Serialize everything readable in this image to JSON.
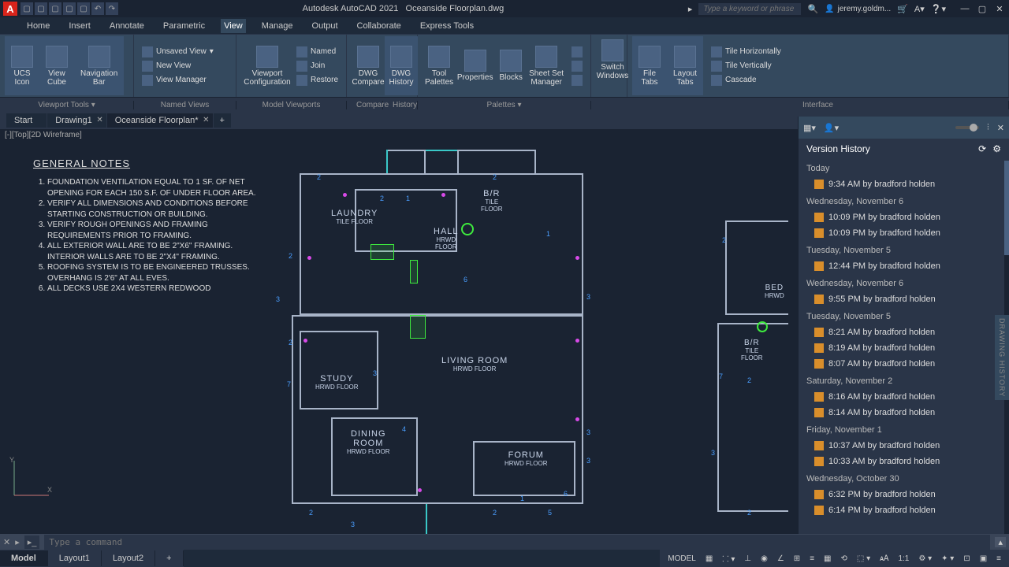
{
  "app": {
    "name": "Autodesk AutoCAD 2021",
    "file": "Oceanside Floorplan.dwg"
  },
  "search": {
    "placeholder": "Type a keyword or phrase"
  },
  "user": {
    "name": "jeremy.goldm..."
  },
  "menu": [
    "Home",
    "Insert",
    "Annotate",
    "Parametric",
    "View",
    "Manage",
    "Output",
    "Collaborate",
    "Express Tools"
  ],
  "menu_active": 4,
  "ribbon": {
    "nav": {
      "ucs": "UCS\nIcon",
      "view": "View\nCube",
      "navbar": "Navigation\nBar",
      "unsaved": "Unsaved View",
      "newview": "New View",
      "viewmgr": "View Manager"
    },
    "vp": {
      "vc": "Viewport\nConfiguration",
      "named": "Named",
      "join": "Join",
      "restore": "Restore"
    },
    "cmp": {
      "dwg": "DWG\nCompare",
      "hist": "DWG\nHistory"
    },
    "pal": {
      "tool": "Tool\nPalettes",
      "prop": "Properties",
      "blocks": "Blocks",
      "sheet": "Sheet Set\nManager"
    },
    "win": {
      "sw": "Switch\nWindows",
      "ft": "File\nTabs",
      "lt": "Layout\nTabs",
      "th": "Tile Horizontally",
      "tv": "Tile Vertically",
      "cas": "Cascade"
    },
    "footer": [
      "Viewport Tools ▾",
      "Named Views",
      "Model Viewports",
      "Compare",
      "History",
      "Palettes ▾",
      "",
      "Interface"
    ]
  },
  "doctabs": [
    {
      "label": "Start"
    },
    {
      "label": "Drawing1",
      "close": true
    },
    {
      "label": "Oceanside Floorplan*",
      "close": true,
      "active": true
    }
  ],
  "viewport_ctrl": "[-][Top][2D Wireframe]",
  "notes": {
    "title": "GENERAL NOTES",
    "items": [
      "FOUNDATION VENTILATION EQUAL TO 1 SF. OF NET OPENING FOR EACH 150 S.F. OF UNDER FLOOR AREA.",
      "VERIFY ALL DIMENSIONS AND CONDITIONS BEFORE STARTING CONSTRUCTION OR BUILDING.",
      "VERIFY ROUGH OPENINGS AND FRAMING REQUIREMENTS PRIOR TO FRAMING.",
      "ALL EXTERIOR WALL ARE TO BE 2\"X6\" FRAMING. INTERIOR WALLS ARE TO BE 2\"X4\" FRAMING.",
      "ROOFING SYSTEM IS TO BE ENGINEERED TRUSSES. OVERHANG IS 2'6\" AT ALL EVES.",
      "ALL DECKS USE 2X4 WESTERN REDWOOD"
    ]
  },
  "rooms": {
    "laundry": {
      "name": "LAUNDRY",
      "sub": "TILE FLOOR"
    },
    "br": {
      "name": "B/R",
      "sub": "TILE\nFLOOR"
    },
    "hall": {
      "name": "HALL",
      "sub": "HRWD\nFLOOR"
    },
    "living": {
      "name": "LIVING ROOM",
      "sub": "HRWD FLOOR"
    },
    "study": {
      "name": "STUDY",
      "sub": "HRWD FLOOR"
    },
    "dining": {
      "name": "DINING\nROOM",
      "sub": "HRWD FLOOR"
    },
    "forum": {
      "name": "FORUM",
      "sub": "HRWD FLOOR"
    },
    "bed": {
      "name": "BED",
      "sub": "HRWD"
    },
    "br2": {
      "name": "B/R",
      "sub": "TILE\nFLOOR"
    }
  },
  "cmd": {
    "placeholder": "Type a command"
  },
  "mtabs": [
    "Model",
    "Layout1",
    "Layout2"
  ],
  "status": {
    "model": "MODEL",
    "scale": "1:1"
  },
  "vh": {
    "title": "Version History",
    "groups": [
      {
        "day": "Today",
        "entries": [
          "9:34 AM by bradford holden"
        ]
      },
      {
        "day": "Wednesday, November 6",
        "entries": [
          "10:09 PM by bradford holden",
          "10:09 PM by bradford holden"
        ]
      },
      {
        "day": "Tuesday, November 5",
        "entries": [
          "12:44 PM by bradford holden"
        ]
      },
      {
        "day": "Wednesday, November 6",
        "entries": [
          "9:55 PM by bradford holden"
        ]
      },
      {
        "day": "Tuesday, November 5",
        "entries": [
          "8:21 AM by bradford holden",
          "8:19 AM by bradford holden",
          "8:07 AM by bradford holden"
        ]
      },
      {
        "day": "Saturday, November 2",
        "entries": [
          "8:16 AM by bradford holden",
          "8:14 AM by bradford holden"
        ]
      },
      {
        "day": "Friday, November 1",
        "entries": [
          "10:37 AM by bradford holden",
          "10:33 AM by bradford holden"
        ]
      },
      {
        "day": "Wednesday, October 30",
        "entries": [
          "6:32 PM by bradford holden",
          "6:14 PM by bradford holden"
        ]
      }
    ]
  },
  "side_label": "DRAWING HISTORY"
}
